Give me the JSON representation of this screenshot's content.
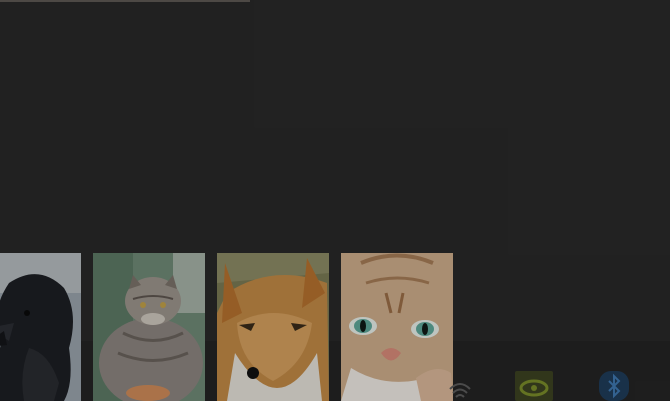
{
  "thumbnails": [
    {
      "subject": "raven",
      "image_icon": "raven-photo"
    },
    {
      "subject": "pallas-cat",
      "image_icon": "pallas-cat-photo"
    },
    {
      "subject": "fox",
      "image_icon": "fox-photo"
    },
    {
      "subject": "cat",
      "image_icon": "cat-photo"
    }
  ],
  "tray_icons": [
    "wifi-icon",
    "nvidia-icon",
    "bluetooth-icon"
  ],
  "colors": {
    "background": "#292929",
    "taskbar": "#242424",
    "progress": "#5f5a55"
  }
}
